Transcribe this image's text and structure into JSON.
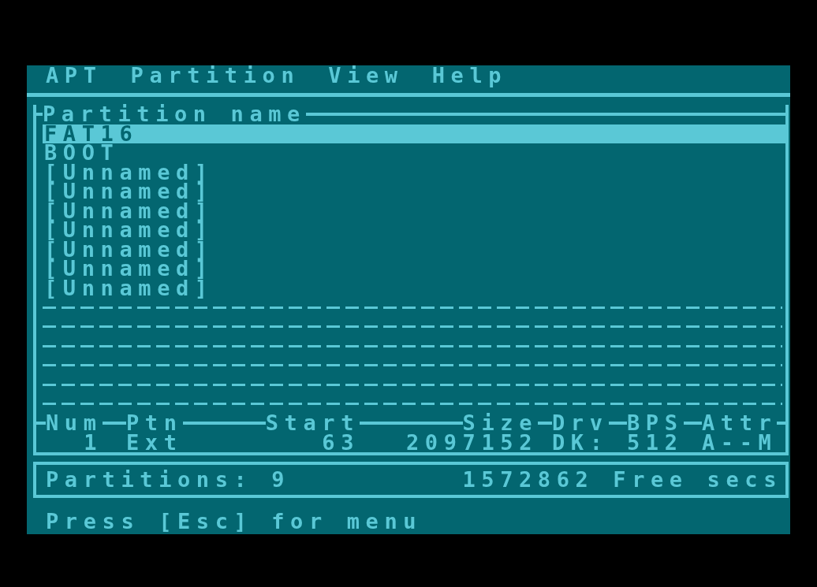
{
  "menu_bar": {
    "items": [
      {
        "label": "APT"
      },
      {
        "label": "Partition"
      },
      {
        "label": "View"
      },
      {
        "label": "Help"
      }
    ]
  },
  "partition_list": {
    "title": "Partition name",
    "items": [
      {
        "kind": "named",
        "name": "FAT16",
        "selected": true
      },
      {
        "kind": "named",
        "name": "BOOT",
        "selected": false
      },
      {
        "kind": "named",
        "name": "[Unnamed]",
        "selected": false
      },
      {
        "kind": "named",
        "name": "[Unnamed]",
        "selected": false
      },
      {
        "kind": "named",
        "name": "[Unnamed]",
        "selected": false
      },
      {
        "kind": "named",
        "name": "[Unnamed]",
        "selected": false
      },
      {
        "kind": "named",
        "name": "[Unnamed]",
        "selected": false
      },
      {
        "kind": "named",
        "name": "[Unnamed]",
        "selected": false
      },
      {
        "kind": "named",
        "name": "[Unnamed]",
        "selected": false
      },
      {
        "kind": "empty",
        "selected": false
      },
      {
        "kind": "empty",
        "selected": false
      },
      {
        "kind": "empty",
        "selected": false
      },
      {
        "kind": "empty",
        "selected": false
      },
      {
        "kind": "empty",
        "selected": false
      },
      {
        "kind": "empty",
        "selected": false
      }
    ]
  },
  "details": {
    "columns": [
      "Num",
      "Ptn",
      "Start",
      "Size",
      "Drv",
      "BPS",
      "Attr"
    ],
    "row": [
      "1",
      "Ext",
      "63",
      "2097152",
      "DK:",
      "512",
      "A--M"
    ]
  },
  "status_bar": {
    "partitions": "Partitions: 9",
    "free_space": "1572862 Free secs"
  },
  "hint": "Press [Esc] for menu"
}
